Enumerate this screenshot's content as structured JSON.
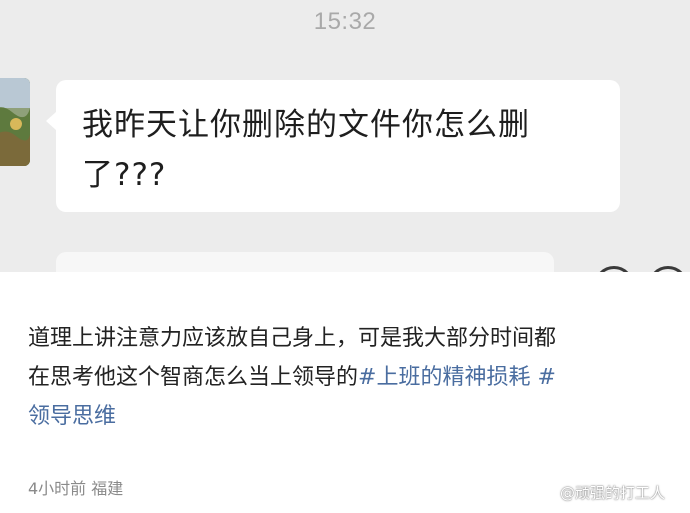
{
  "chat": {
    "timestamp": "15:32",
    "message_line1": "我昨天让你删除的文件你怎么删",
    "message_line2": "了???"
  },
  "post": {
    "text_line1": "道理上讲注意力应该放自己身上，可是我大部分时间都",
    "text_line2_plain": "在思考他这个智商怎么当上领导的",
    "hashtag1": "#上班的精神损耗 #",
    "hashtag2": "领导思维",
    "meta": "4小时前 福建"
  },
  "watermark": {
    "text": "@顽强的打工人",
    "icon": "weibo-icon"
  }
}
